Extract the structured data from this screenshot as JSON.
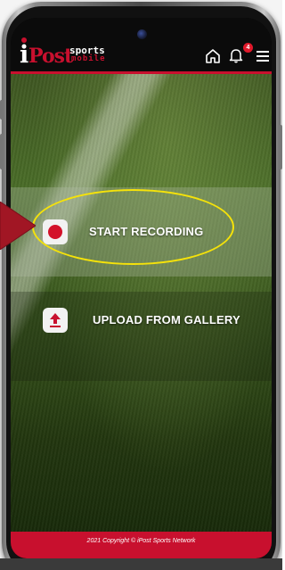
{
  "header": {
    "logo": {
      "i": "i",
      "post": "Post",
      "sports": "sports",
      "mobile": "mobile"
    },
    "icons": {
      "home": "home-icon",
      "bell": "bell-icon",
      "menu": "menu-icon"
    },
    "notification_count": "4"
  },
  "actions": {
    "record": {
      "label": "START RECORDING",
      "icon": "record-icon"
    },
    "upload": {
      "label": "UPLOAD FROM GALLERY",
      "icon": "upload-icon"
    }
  },
  "footer": {
    "copyright": "2021 Copyright © iPost Sports Network"
  },
  "colors": {
    "brand_red": "#c8102e",
    "highlight_yellow": "#f5e20a",
    "header_bg": "#0b0b0b"
  }
}
